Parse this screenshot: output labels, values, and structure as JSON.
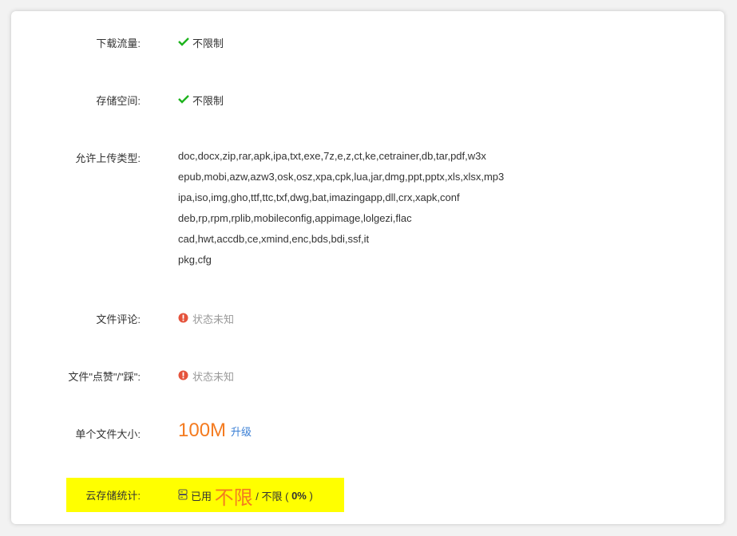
{
  "download": {
    "label": "下载流量:",
    "value": "不限制",
    "icon": "check-icon",
    "icon_color": "#1db31d"
  },
  "storage": {
    "label": "存储空间:",
    "value": "不限制",
    "icon": "check-icon",
    "icon_color": "#1db31d"
  },
  "types": {
    "label": "允许上传类型:",
    "lines": [
      "doc,docx,zip,rar,apk,ipa,txt,exe,7z,e,z,ct,ke,cetrainer,db,tar,pdf,w3x",
      "epub,mobi,azw,azw3,osk,osz,xpa,cpk,lua,jar,dmg,ppt,pptx,xls,xlsx,mp3",
      "ipa,iso,img,gho,ttf,ttc,txf,dwg,bat,imazingapp,dll,crx,xapk,conf",
      "deb,rp,rpm,rplib,mobileconfig,appimage,lolgezi,flac",
      "cad,hwt,accdb,ce,xmind,enc,bds,bdi,ssf,it",
      "pkg,cfg"
    ]
  },
  "comment": {
    "label": "文件评论:",
    "status": "状态未知",
    "icon": "warning-icon",
    "icon_color": "#e5533c"
  },
  "like": {
    "label": "文件\"点赞\"/\"踩\":",
    "status": "状态未知",
    "icon": "warning-icon",
    "icon_color": "#e5533c"
  },
  "filesize": {
    "label": "单个文件大小:",
    "value": "100M",
    "upgrade": "升级",
    "value_color": "#f47b20",
    "link_color": "#3a7fd5"
  },
  "stats": {
    "label": "云存储统计:",
    "icon": "storage-icon",
    "used_prefix": "已用",
    "used_value": "不限",
    "separator": "/ 不限 (",
    "percent": "0%",
    "suffix": ")",
    "highlight_color": "#ffff00"
  }
}
